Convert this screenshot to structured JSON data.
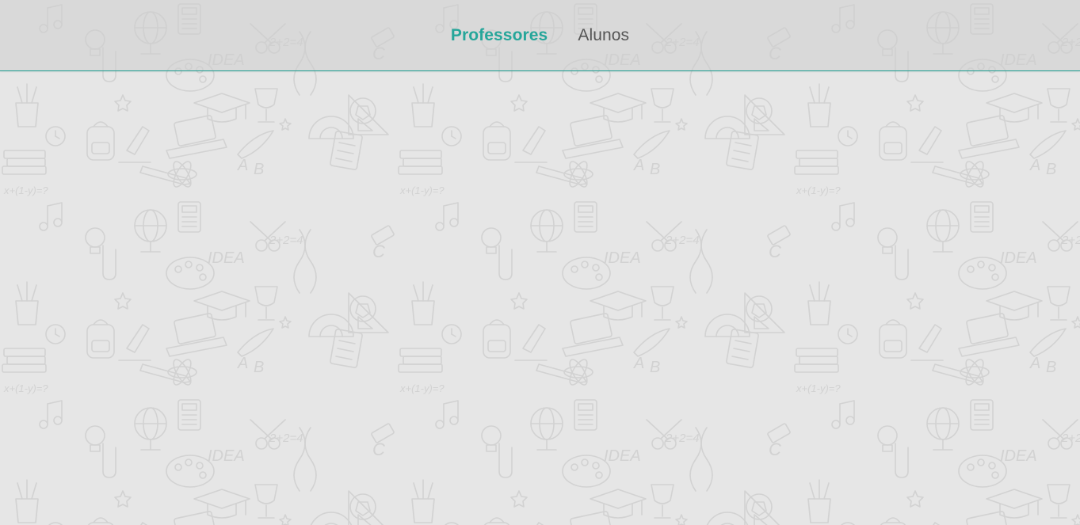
{
  "nav": {
    "tabs": [
      {
        "label": "Professores",
        "active": true
      },
      {
        "label": "Alunos",
        "active": false
      }
    ]
  },
  "colors": {
    "accent": "#26a69a",
    "inactive_tab": "#555555",
    "background": "#e6e6e6",
    "divider": "#1a9c8f"
  },
  "background_pattern": {
    "doodle_texts": [
      "IDEA",
      "2+2=4",
      "x+(1-y)=?",
      "A",
      "B",
      "C"
    ]
  }
}
